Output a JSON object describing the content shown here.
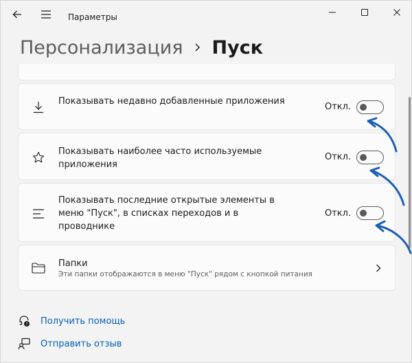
{
  "app": {
    "title": "Параметры"
  },
  "breadcrumb": {
    "parent": "Персонализация",
    "current": "Пуск"
  },
  "settings": [
    {
      "label": "Показывать недавно добавленные приложения",
      "state": "Откл.",
      "enabled": false,
      "icon": "download-icon"
    },
    {
      "label": "Показывать наиболее часто используемые приложения",
      "state": "Откл.",
      "enabled": false,
      "icon": "star-icon"
    },
    {
      "label": "Показывать последние открытые элементы в меню \"Пуск\", в списках переходов и в проводнике",
      "state": "Откл.",
      "enabled": false,
      "icon": "list-icon"
    }
  ],
  "folders": {
    "title": "Папки",
    "description": "Эти папки отображаются в меню \"Пуск\" рядом с кнопкой питания",
    "icon": "folder-icon"
  },
  "links": [
    {
      "label": "Получить помощь",
      "icon": "help-icon"
    },
    {
      "label": "Отправить отзыв",
      "icon": "feedback-icon"
    }
  ],
  "colors": {
    "accent_link": "#005fb8",
    "annotation_arrow": "#1a5fb4",
    "background": "#f3f3f3",
    "card": "#fbfbfb"
  }
}
